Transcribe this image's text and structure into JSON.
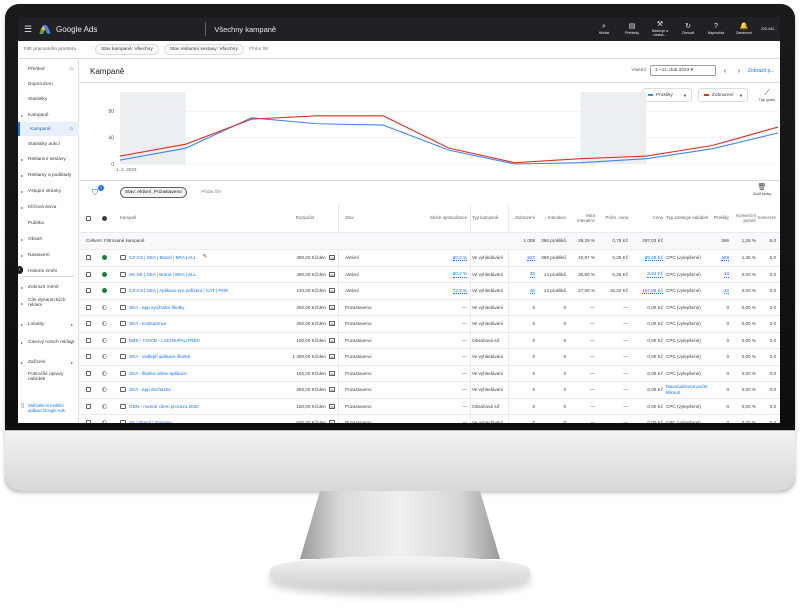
{
  "topbar": {
    "app_name": "Google Ads",
    "page_title": "Všechny kampaně",
    "actions": [
      {
        "icon": "search-icon",
        "label": "Hledat"
      },
      {
        "icon": "reports-icon",
        "label": "Přehledy"
      },
      {
        "icon": "tools-icon",
        "label": "Nástroje a nastav..."
      },
      {
        "icon": "refresh-icon",
        "label": "Obnovit"
      },
      {
        "icon": "help-icon",
        "label": "Nápověda"
      },
      {
        "icon": "bell-icon",
        "label": "Oznámení"
      }
    ],
    "account": "225-442..."
  },
  "filterbar": {
    "label": "Filtr pracovního prostoru",
    "chips": [
      "Stav kampaně: Všechny",
      "Stav reklamní sestavy: Všechny"
    ],
    "add_label": "Přidat filtr"
  },
  "sidebar": {
    "items": [
      {
        "label": "Přehled",
        "arrow": false,
        "home": true
      },
      {
        "label": "Doporučení",
        "arrow": false
      },
      {
        "label": "Statistiky",
        "arrow": false
      },
      {
        "label": "Kampaně",
        "arrow": true
      },
      {
        "label": "Kampaně",
        "arrow": false,
        "active": true,
        "home": true
      },
      {
        "label": "Statistiky aukcí",
        "arrow": false
      },
      {
        "label": "Reklamní sestavy",
        "arrow": true
      },
      {
        "label": "Reklamy a podklady",
        "arrow": true
      },
      {
        "label": "Vstupní stránky",
        "arrow": true
      },
      {
        "label": "Klíčová slova",
        "arrow": true
      },
      {
        "label": "Publika",
        "arrow": false
      },
      {
        "label": "Obsah",
        "arrow": true
      },
      {
        "label": "Nastavení",
        "arrow": true
      },
      {
        "label": "Historie změn",
        "arrow": false
      },
      {
        "label": "Zobrazit méně",
        "arrow": true
      },
      {
        "label": "Cíle dynamických reklam",
        "arrow": true
      },
      {
        "label": "Lokality",
        "arrow": true,
        "red": true
      },
      {
        "label": "Časový rozvrh reklam",
        "arrow": true,
        "red": true
      },
      {
        "label": "Zařízení",
        "arrow": true,
        "red": true
      },
      {
        "label": "Pokročilé úpravy nabídek",
        "arrow": false
      }
    ],
    "bottom_link": "Stáhněte si mobilní aplikaci Google Ads"
  },
  "header": {
    "title": "Kampaně",
    "date_label": "Vlastní",
    "date_range": "1.–11. dub 2023",
    "view_link": "Zobrazit p..."
  },
  "chart_controls": {
    "metric1": {
      "label": "Prokliky",
      "color": "#4285f4"
    },
    "metric2": {
      "label": "Zobrazení",
      "color": "#d93025"
    },
    "chart_type": "Typ grafu"
  },
  "chart_data": {
    "type": "line",
    "x": [
      "1. 4. 2023",
      "2. 4.",
      "3. 4.",
      "4. 4.",
      "5. 4.",
      "6. 4.",
      "7. 4.",
      "8. 4.",
      "9. 4.",
      "10. 4.",
      "11. 4."
    ],
    "y_ticks": [
      0,
      40,
      80
    ],
    "ylim": [
      0,
      100
    ],
    "series": [
      {
        "name": "Prokliky",
        "color": "#4285f4",
        "values": [
          6,
          24,
          70,
          61,
          59,
          21,
          0,
          2,
          8,
          23,
          47
        ]
      },
      {
        "name": "Zobrazení",
        "color": "#d93025",
        "values": [
          12,
          30,
          68,
          73,
          73,
          24,
          2,
          8,
          12,
          28,
          56
        ]
      }
    ],
    "grid": true,
    "shaded_weekends": [
      [
        0,
        1
      ],
      [
        7,
        8
      ]
    ]
  },
  "table_toolbar": {
    "filter_count": "1",
    "active_filter": "Stav: Aktivní, Pozastaveno",
    "add_filter": "Přidat filtr",
    "columns_btn": "Zúžit řádky"
  },
  "table": {
    "headers": [
      "Kampaň",
      "Rozpočet",
      "Stav",
      "Skóre optimalizace",
      "Typ kampaně",
      "Zobrazení",
      "↓ Interakce",
      "Míra interakce",
      "Prům. cena",
      "Cena",
      "Typ strategie nabídek",
      "Prokliky",
      "Konverzní poměr",
      "Konverze"
    ],
    "total": {
      "label": "Celkem: Filtrované kampaně",
      "values": [
        "",
        "",
        "",
        "",
        "1 008",
        "396 prokliků",
        "39,29 %",
        "0,75 Kč",
        "297,03 Kč",
        "",
        "396",
        "1,26 %",
        "5,0"
      ]
    },
    "rows": [
      {
        "status": "green",
        "name": "CZ-CS | SEA | Brand | BRA | ALL",
        "budget": "490,00 Kč/den",
        "state": "Aktivní",
        "score": "60,2 %",
        "type": "Ve vyhledávání",
        "impr": "927",
        "inter": "369 prokliků",
        "rate": "40,87 %",
        "cpc": "0,26 Kč",
        "cost": "95,25 Kč",
        "strategy": "CPC (vylepšené)",
        "clicks": "369",
        "conv_rate": "1,36 %",
        "conv": "5,0",
        "pencil": true
      },
      {
        "status": "green",
        "name": "SK-SK | SEA | Brand | BRA | ALL",
        "budget": "490,00 Kč/den",
        "state": "Aktivní",
        "score": "60,2 %",
        "type": "Ve vyhledávání",
        "impr": "35",
        "inter": "14 prokliků",
        "rate": "35,90 %",
        "cpc": "0,26 Kč",
        "cost": "3,64 Kč",
        "strategy": "CPC (vylepšené)",
        "clicks": "14",
        "conv_rate": "0,00 %",
        "conv": "0,0"
      },
      {
        "status": "green",
        "name": "CZ-CS | SEA | Aplikace pro zařízení | CAT | PNR",
        "budget": "210,00 Kč/den",
        "state": "Aktivní",
        "score": "72,9 %",
        "type": "Ve vyhledávání",
        "impr": "48",
        "inter": "13 prokliků",
        "rate": "27,08 %",
        "cpc": "15,22 Kč",
        "cost": "197,89 Kč",
        "strategy": "CPC (vylepšené)",
        "clicks": "13",
        "conv_rate": "0,00 %",
        "conv": "0,0"
      },
      {
        "status": "gray",
        "name": "SEA - app využívání školky",
        "budget": "250,00 Kč/den",
        "state": "Pozastaveno",
        "score": "—",
        "type": "Ve vyhledávání",
        "impr": "0",
        "inter": "0",
        "rate": "—",
        "cpc": "—",
        "cost": "0,00 Kč",
        "strategy": "CPC (vylepšené)",
        "clicks": "0",
        "conv_rate": "0,00 %",
        "conv": "0,0"
      },
      {
        "status": "gray",
        "name": "SEA - kosikarence",
        "budget": "250,00 Kč/den",
        "state": "Pozastaveno",
        "score": "—",
        "type": "Ve vyhledávání",
        "impr": "0",
        "inter": "0",
        "rate": "—",
        "cpc": "—",
        "cost": "0,00 Kč",
        "strategy": "CPC (vylepšené)",
        "clicks": "0",
        "conv_rate": "0,00 %",
        "conv": "0,0"
      },
      {
        "status": "gray",
        "name": "DBS - COVID - LSCHK/PAL/TRED",
        "budget": "100,00 Kč/den",
        "state": "Pozastaveno",
        "score": "—",
        "type": "Obsahová síť",
        "impr": "0",
        "inter": "0",
        "rate": "—",
        "cpc": "—",
        "cost": "0,00 Kč",
        "strategy": "CPC (vylepšené)",
        "clicks": "0",
        "conv_rate": "0,00 %",
        "conv": "0,0"
      },
      {
        "status": "gray",
        "name": "SEA - vedlejší aplikace školek",
        "budget": "1 400,00 Kč/den",
        "state": "Pozastaveno",
        "score": "—",
        "type": "Ve vyhledávání",
        "impr": "0",
        "inter": "0",
        "rate": "—",
        "cpc": "—",
        "cost": "0,00 Kč",
        "strategy": "CPC (vylepšené)",
        "clicks": "0",
        "conv_rate": "0,00 %",
        "conv": "0,0"
      },
      {
        "status": "gray",
        "name": "SEA - školka online aplikace",
        "budget": "150,00 Kč/den",
        "state": "Pozastaveno",
        "score": "—",
        "type": "Ve vyhledávání",
        "impr": "0",
        "inter": "0",
        "rate": "—",
        "cpc": "—",
        "cost": "0,00 Kč",
        "strategy": "CPC (vylepšené)",
        "clicks": "0",
        "conv_rate": "0,00 %",
        "conv": "0,0"
      },
      {
        "status": "gray",
        "name": "SEA - app dochazka",
        "budget": "250,00 Kč/den",
        "state": "Pozastaveno",
        "score": "—",
        "type": "Ve vyhledávání",
        "impr": "0",
        "inter": "0",
        "rate": "—",
        "cpc": "—",
        "cost": "0,00 Kč",
        "strategy": "Maximalizovat počet kliknutí",
        "clicks": "0",
        "conv_rate": "0,00 %",
        "conv": "0,0"
      },
      {
        "status": "gray",
        "name": "GDN - rozené cílení provozu 2020",
        "budget": "150,00 Kč/den",
        "state": "Pozastaveno",
        "score": "—",
        "type": "Obsahová síť",
        "impr": "0",
        "inter": "0",
        "rate": "—",
        "cpc": "—",
        "cost": "0,00 Kč",
        "strategy": "CPC (vylepšené)",
        "clicks": "0",
        "conv_rate": "0,00 %",
        "conv": "0,0"
      },
      {
        "status": "gray",
        "name": "SK | Brand | Twgwee",
        "budget": "600,00 Kč/den",
        "state": "Pozastaveno",
        "score": "—",
        "type": "Ve vyhledávání",
        "impr": "0",
        "inter": "0",
        "rate": "—",
        "cpc": "—",
        "cost": "0,00 Kč",
        "strategy": "CPC (vylepšené)",
        "clicks": "0",
        "conv_rate": "0,00 %",
        "conv": "0,0"
      },
      {
        "status": "gray",
        "name": "SEA - dostatek výuka LP",
        "budget": "150,00 Kč/den",
        "state": "Pozastaveno\nByly pozastaveny všechny reklamní ses",
        "score": "—",
        "type": "Ve vyhledávání",
        "impr": "0",
        "inter": "0",
        "rate": "—",
        "cpc": "—",
        "cost": "0,00 Kč",
        "strategy": "Maximalizace počtu konverzí (Cílová CPA)",
        "clicks": "0",
        "conv_rate": "0,00 %",
        "conv": "0,0"
      }
    ]
  }
}
